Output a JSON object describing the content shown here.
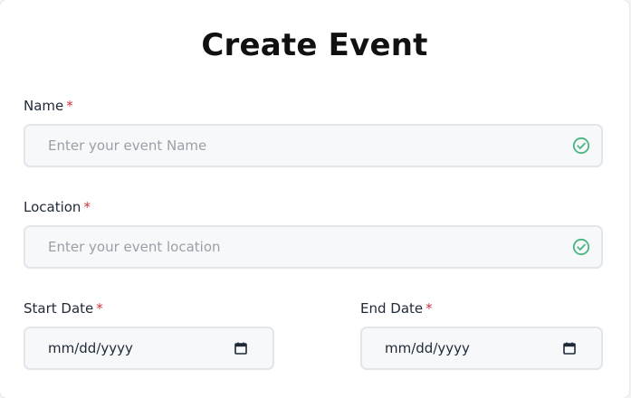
{
  "form": {
    "title": "Create Event",
    "required_mark": "*",
    "name": {
      "label": "Name",
      "placeholder": "Enter your event Name"
    },
    "location": {
      "label": "Location",
      "placeholder": "Enter your event location"
    },
    "start_date": {
      "label": "Start Date",
      "value": "mm/dd/yyyy"
    },
    "end_date": {
      "label": "End Date",
      "value": "mm/dd/yyyy"
    }
  },
  "icons": {
    "valid": "check-circle-icon",
    "calendar": "calendar-icon"
  },
  "colors": {
    "valid_green": "#48b583",
    "required_red": "#d4333f",
    "field_bg": "#f7f8fa",
    "field_border": "#e2e5e9"
  }
}
